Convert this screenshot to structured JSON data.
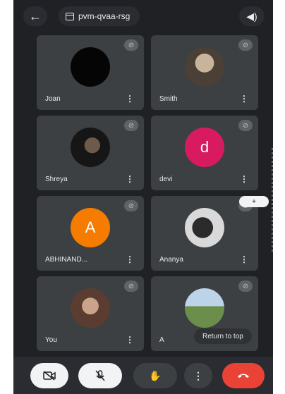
{
  "topbar": {
    "back_icon": "arrow-left-icon",
    "meeting_code": "pvm-qvaa-rsg",
    "speaker_icon": "speaker-icon"
  },
  "participants": [
    {
      "name": "Joan",
      "avatar_type": "photo",
      "avatar_color": "#0a0a0a",
      "initial": ""
    },
    {
      "name": "Smith",
      "avatar_type": "photo",
      "avatar_color": "#7a6a5a",
      "initial": ""
    },
    {
      "name": "Shreya",
      "avatar_type": "photo",
      "avatar_color": "#2a2a2a",
      "initial": ""
    },
    {
      "name": "devi",
      "avatar_type": "initial",
      "avatar_color": "#d81b60",
      "initial": "d"
    },
    {
      "name": "ABHINAND...",
      "avatar_type": "initial",
      "avatar_color": "#f57c00",
      "initial": "A"
    },
    {
      "name": "Ananya",
      "avatar_type": "photo",
      "avatar_color": "#9e9e9e",
      "initial": ""
    },
    {
      "name": "You",
      "avatar_type": "photo",
      "avatar_color": "#8d6e63",
      "initial": ""
    },
    {
      "name": "A",
      "avatar_type": "photo",
      "avatar_color": "#8fa9c7",
      "initial": ""
    }
  ],
  "floating_button": "+",
  "return_to_top": "Return to top",
  "controls": {
    "camera_icon": "camera-off-icon",
    "mic_icon": "mic-off-icon",
    "hand_icon": "raise-hand-icon",
    "more_icon": "more-vertical-icon",
    "end_call_icon": "end-call-icon"
  },
  "colors": {
    "background": "#1f2125",
    "tile": "#3c4043",
    "end_call": "#ea4335"
  }
}
